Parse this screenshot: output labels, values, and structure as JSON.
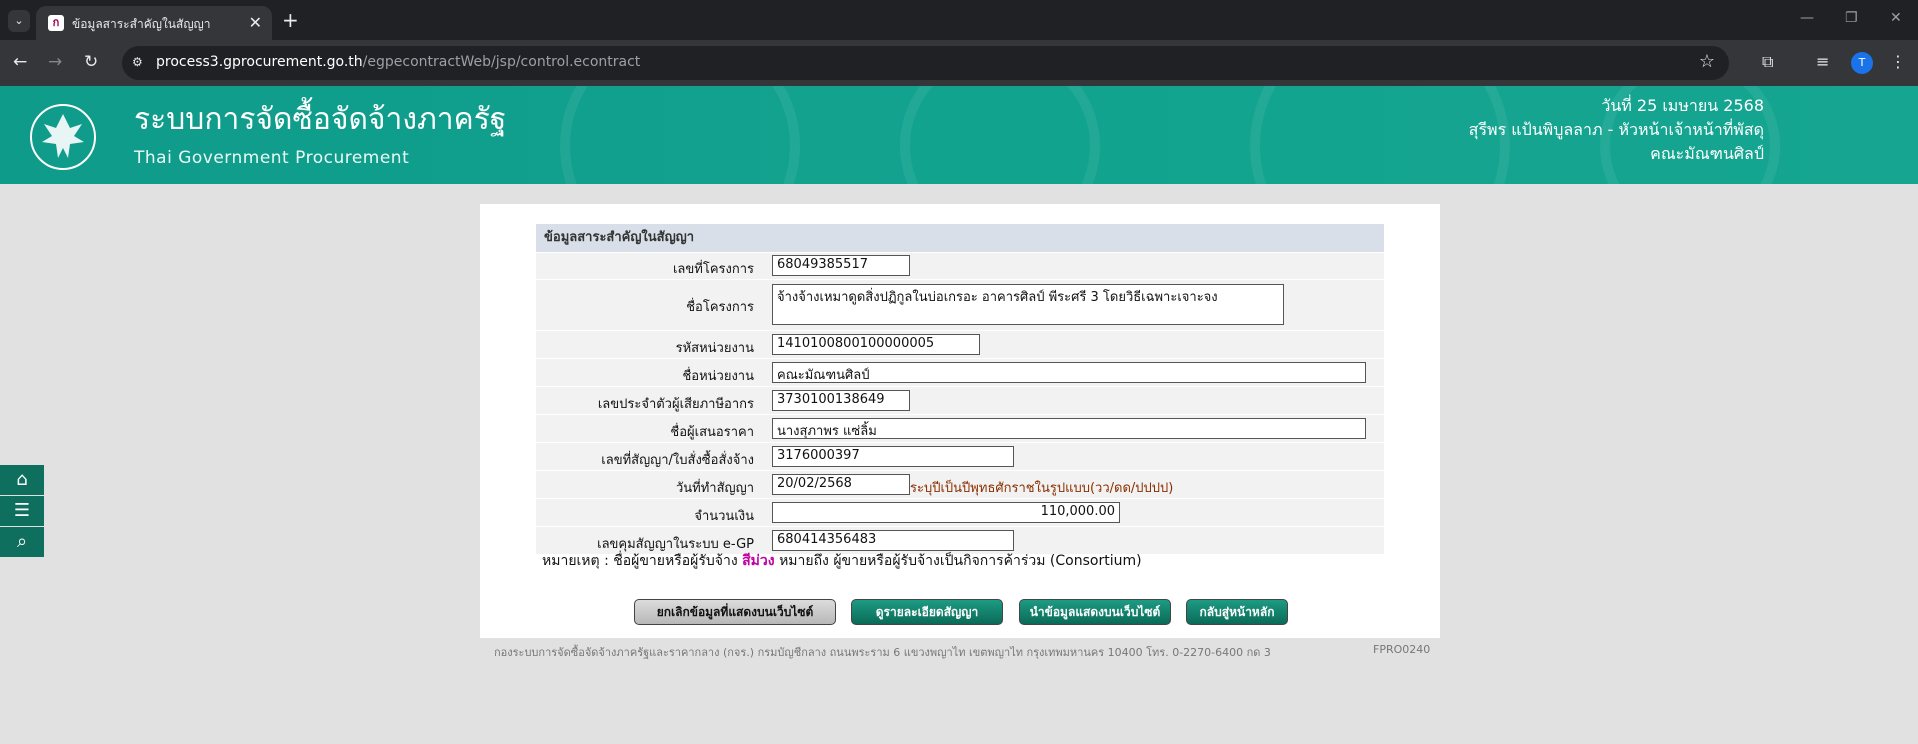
{
  "browser": {
    "tab_title": "ข้อมูลสาระสำคัญในสัญญา",
    "url_host": "process3.gprocurement.go.th",
    "url_path": "/egpecontractWeb/jsp/control.econtract",
    "profile_initial": "T"
  },
  "header": {
    "title": "ระบบการจัดซื้อจัดจ้างภาครัฐ",
    "subtitle": "Thai Government Procurement",
    "date": "วันที่ 25 เมษายน 2568",
    "user": "สุรีพร แป้นพิบูลลาภ - หัวหน้าเจ้าหน้าที่พัสดุ",
    "org": "คณะมัณฑนศิลป์"
  },
  "form": {
    "heading": "ข้อมูลสาระสำคัญในสัญญา",
    "fields": [
      {
        "label": "เลขที่โครงการ",
        "value": "68049385517"
      },
      {
        "label": "ชื่อโครงการ",
        "value": "จ้างจ้างเหมาดูดสิ่งปฏิกูลในบ่อเกรอะ อาคารศิลป์ พีระศรี 3 โดยวิธีเฉพาะเจาะจง"
      },
      {
        "label": "รหัสหน่วยงาน",
        "value": "1410100800100000005"
      },
      {
        "label": "ชื่อหน่วยงาน",
        "value": "คณะมัณฑนศิลป์"
      },
      {
        "label": "เลขประจำตัวผู้เสียภาษีอากร",
        "value": "3730100138649"
      },
      {
        "label": "ชื่อผู้เสนอราคา",
        "value": "นางสุภาพร แซ่ลิ้ม"
      },
      {
        "label": "เลขที่สัญญา/ใบสั่งซื้อสั่งจ้าง",
        "value": "3176000397"
      },
      {
        "label": "วันที่ทำสัญญา",
        "value": "20/02/2568",
        "hint": "ระบุปีเป็นปีพุทธศักราชในรูปแบบ(วว/ดด/ปปปป)"
      },
      {
        "label": "จำนวนเงิน",
        "value": "110,000.00"
      },
      {
        "label": "เลขคุมสัญญาในระบบ e-GP",
        "value": "680414356483"
      }
    ],
    "note_prefix": "หมายเหตุ : ชื่อผู้ขายหรือผู้รับจ้าง",
    "note_color_word": "สีม่วง",
    "note_suffix": "หมายถึง ผู้ขายหรือผู้รับจ้างเป็นกิจการค้าร่วม (Consortium)"
  },
  "buttons": {
    "cancel_publish": "ยกเลิกข้อมูลที่แสดงบนเว็บไซต์",
    "view_contract": "ดูรายละเอียดสัญญา",
    "publish": "นำข้อมูลแสดงบนเว็บไซต์",
    "back_home": "กลับสู่หน้าหลัก"
  },
  "footer": {
    "text": "กองระบบการจัดซื้อจัดจ้างภาครัฐและราคากลาง (กจร.) กรมบัญชีกลาง ถนนพระราม 6 แขวงพญาไท เขตพญาไท กรุงเทพมหานคร 10400 โทร. 0-2270-6400 กด 3",
    "code": "FPRO0240"
  },
  "colors": {
    "banner": "#12a38f",
    "button_green": "#0b6a58",
    "purple": "#c000a0"
  }
}
